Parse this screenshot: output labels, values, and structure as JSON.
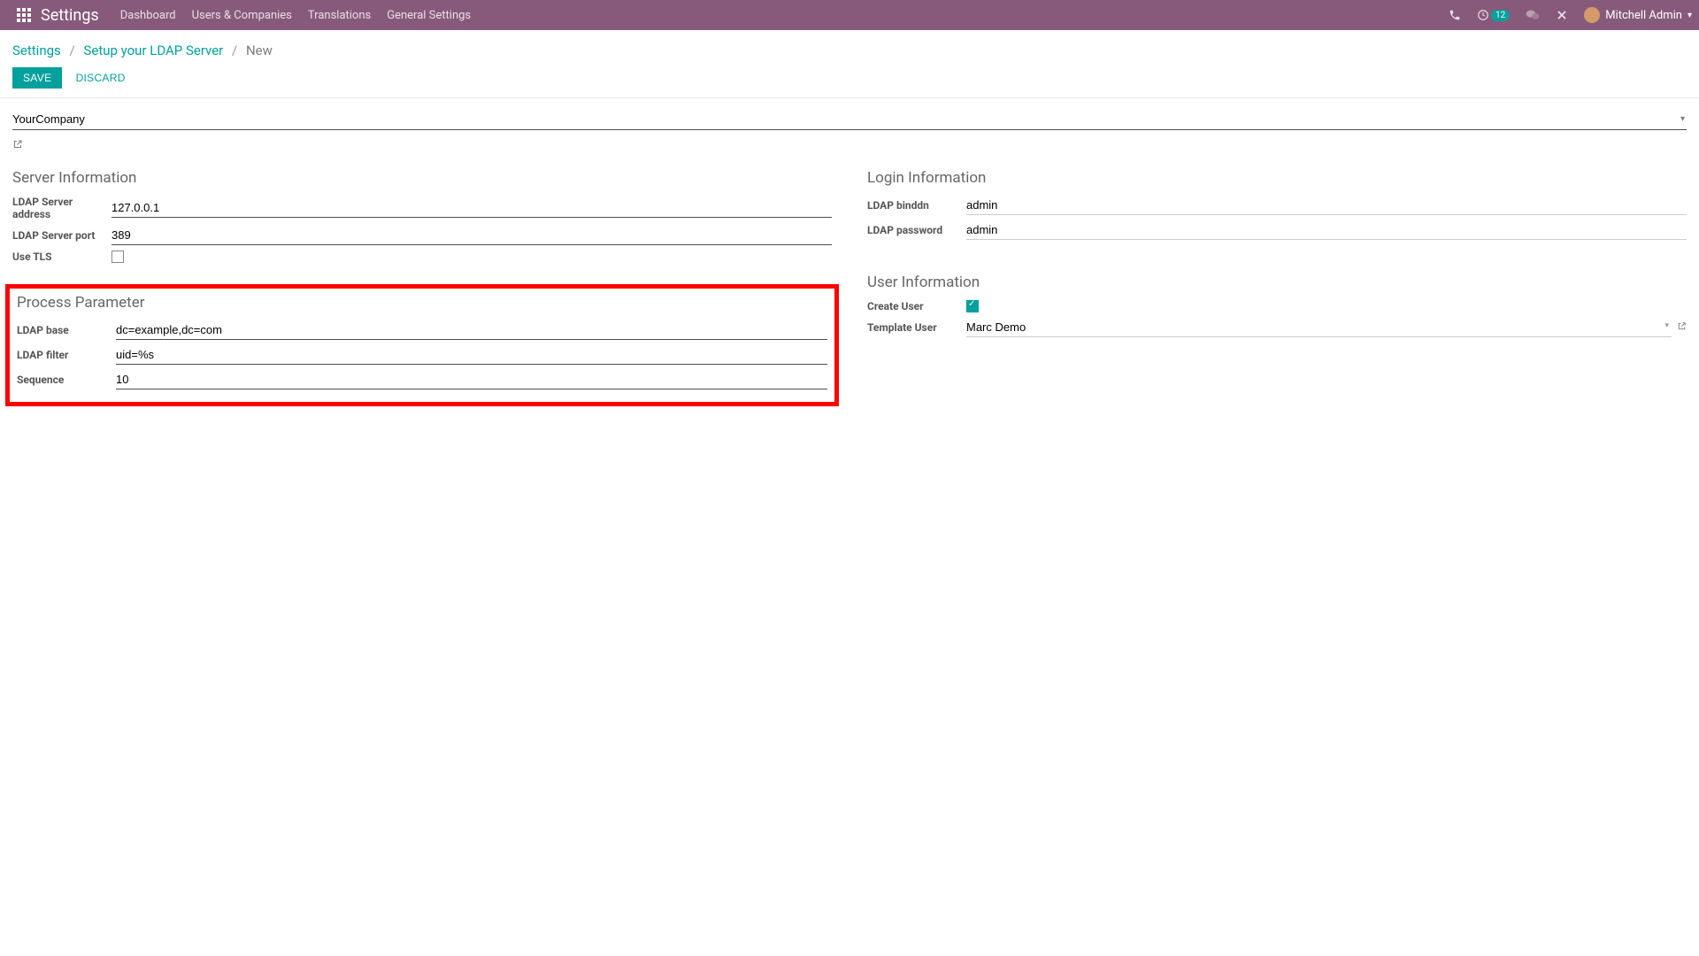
{
  "navbar": {
    "brand": "Settings",
    "menu": [
      {
        "label": "Dashboard"
      },
      {
        "label": "Users & Companies"
      },
      {
        "label": "Translations"
      },
      {
        "label": "General Settings"
      }
    ],
    "activity_badge": "12",
    "user": "Mitchell Admin"
  },
  "breadcrumb": {
    "root": "Settings",
    "mid": "Setup your LDAP Server",
    "current": "New"
  },
  "buttons": {
    "save": "SAVE",
    "discard": "DISCARD"
  },
  "company": {
    "value": "YourCompany"
  },
  "sections": {
    "server_info": {
      "title": "Server Information",
      "fields": {
        "address_label": "LDAP Server address",
        "address_value": "127.0.0.1",
        "port_label": "LDAP Server port",
        "port_value": "389",
        "tls_label": "Use TLS"
      }
    },
    "login_info": {
      "title": "Login Information",
      "fields": {
        "binddn_label": "LDAP binddn",
        "binddn_value": "admin",
        "password_label": "LDAP password",
        "password_value": "admin"
      }
    },
    "process_param": {
      "title": "Process Parameter",
      "fields": {
        "base_label": "LDAP base",
        "base_value": "dc=example,dc=com",
        "filter_label": "LDAP filter",
        "filter_value": "uid=%s",
        "sequence_label": "Sequence",
        "sequence_value": "10"
      }
    },
    "user_info": {
      "title": "User Information",
      "fields": {
        "create_user_label": "Create User",
        "template_user_label": "Template User",
        "template_user_value": "Marc Demo"
      }
    }
  }
}
